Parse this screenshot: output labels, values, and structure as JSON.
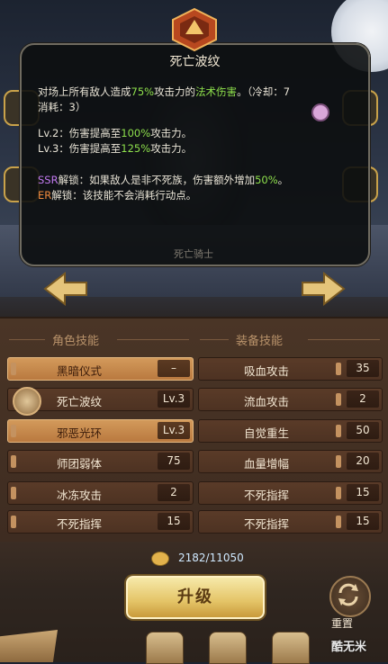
{
  "tooltip": {
    "title": "死亡波纹",
    "line1_pre": "对场上所有敌人造成",
    "line1_pct": "75%",
    "line1_mid": "攻击力的",
    "line1_type": "法术伤害",
    "line1_post": "。（冷却：7",
    "line2": "消耗：3）",
    "lv2_pre": "Lv.2：伤害提高至",
    "lv2_pct": "100%",
    "lv2_post": "攻击力。",
    "lv3_pre": "Lv.3：伤害提高至",
    "lv3_pct": "125%",
    "lv3_post": "攻击力。",
    "ssr_tag": "SSR",
    "ssr_pre": "解锁：如果敌人是非不死族，伤害额外增加",
    "ssr_pct": "50%",
    "ssr_post": "。",
    "er_tag": "ER",
    "er_text": "解锁：该技能不会消耗行动点。"
  },
  "hero_name": "死亡骑士",
  "role_skills_header": "角色技能",
  "equip_skills_header": "装备技能",
  "role_skills": [
    {
      "name": "黑暗仪式",
      "value": "–",
      "selected": true
    },
    {
      "name": "死亡波纹",
      "value": "Lv.3",
      "selected": false
    },
    {
      "name": "邪恶光环",
      "value": "Lv.3",
      "selected": true
    },
    {
      "name": "师团弱体",
      "value": "75",
      "selected": false
    },
    {
      "name": "冰冻攻击",
      "value": "2",
      "selected": false
    },
    {
      "name": "不死指挥",
      "value": "15",
      "selected": false
    }
  ],
  "equip_skills": [
    {
      "name": "吸血攻击",
      "value": "35"
    },
    {
      "name": "流血攻击",
      "value": "2"
    },
    {
      "name": "自觉重生",
      "value": "50"
    },
    {
      "name": "血量增幅",
      "value": "20"
    },
    {
      "name": "不死指挥",
      "value": "15"
    },
    {
      "name": "不死指挥",
      "value": "15"
    }
  ],
  "currency": "2182/11050",
  "upgrade_label": "升级",
  "reset_label": "重置",
  "watermark": "酷无米"
}
